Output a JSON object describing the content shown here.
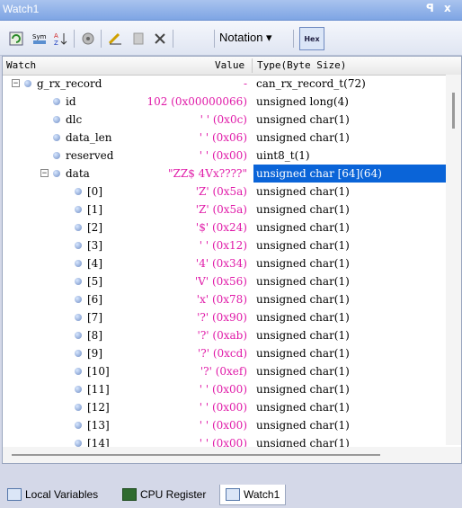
{
  "window": {
    "title": "Watch1",
    "pin": "ꟼ",
    "close": "x"
  },
  "toolbar": {
    "notation_label": "Notation ▾",
    "hex_label": "Hex"
  },
  "header": {
    "watch": "Watch",
    "value": "Value",
    "type": "Type(Byte Size)"
  },
  "rows": [
    {
      "name": "g_rx_record",
      "value": "-",
      "type": "can_rx_record_t(72)"
    },
    {
      "name": "id",
      "value": "102 (0x00000066)",
      "type": "unsigned long(4)"
    },
    {
      "name": "dlc",
      "value": "' ' (0x0c)",
      "type": "unsigned char(1)"
    },
    {
      "name": "data_len",
      "value": "' ' (0x06)",
      "type": "unsigned char(1)"
    },
    {
      "name": "reserved",
      "value": "' ' (0x00)",
      "type": "uint8_t(1)"
    },
    {
      "name": "data",
      "value": "\"ZZ$ 4Vx????\"",
      "type": "unsigned char [64](64)"
    },
    {
      "name": "[0]",
      "value": "'Z' (0x5a)",
      "type": "unsigned char(1)"
    },
    {
      "name": "[1]",
      "value": "'Z' (0x5a)",
      "type": "unsigned char(1)"
    },
    {
      "name": "[2]",
      "value": "'$' (0x24)",
      "type": "unsigned char(1)"
    },
    {
      "name": "[3]",
      "value": "' ' (0x12)",
      "type": "unsigned char(1)"
    },
    {
      "name": "[4]",
      "value": "'4' (0x34)",
      "type": "unsigned char(1)"
    },
    {
      "name": "[5]",
      "value": "'V' (0x56)",
      "type": "unsigned char(1)"
    },
    {
      "name": "[6]",
      "value": "'x' (0x78)",
      "type": "unsigned char(1)"
    },
    {
      "name": "[7]",
      "value": "'?' (0x90)",
      "type": "unsigned char(1)"
    },
    {
      "name": "[8]",
      "value": "'?' (0xab)",
      "type": "unsigned char(1)"
    },
    {
      "name": "[9]",
      "value": "'?' (0xcd)",
      "type": "unsigned char(1)"
    },
    {
      "name": "[10]",
      "value": "'?' (0xef)",
      "type": "unsigned char(1)"
    },
    {
      "name": "[11]",
      "value": "' ' (0x00)",
      "type": "unsigned char(1)"
    },
    {
      "name": "[12]",
      "value": "' ' (0x00)",
      "type": "unsigned char(1)"
    },
    {
      "name": "[13]",
      "value": "' ' (0x00)",
      "type": "unsigned char(1)"
    },
    {
      "name": "[14]",
      "value": "' ' (0x00)",
      "type": "unsigned char(1)"
    }
  ],
  "tabs": [
    {
      "label": "Local Variables"
    },
    {
      "label": "CPU Register"
    },
    {
      "label": "Watch1"
    }
  ],
  "colors": {
    "value": "#e01aa8",
    "selection": "#0a64d8"
  }
}
